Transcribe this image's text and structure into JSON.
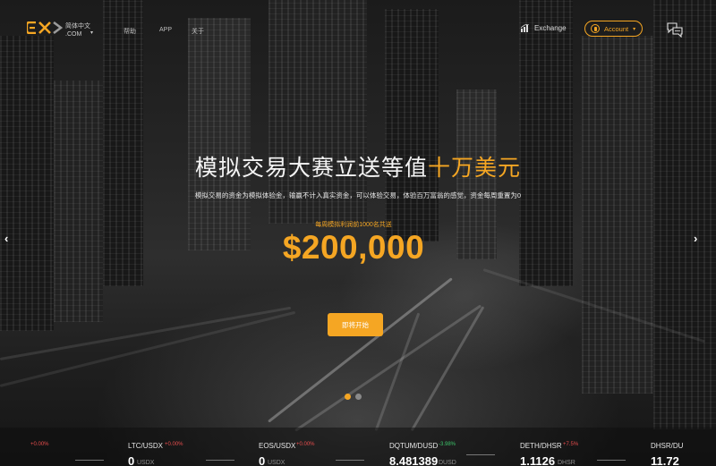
{
  "header": {
    "logo_text": "EXX",
    "language": "简体中文",
    "domain": ".COM",
    "nav": [
      "帮助",
      "APP",
      "关于"
    ],
    "exchange_label": "Exchange",
    "account_label": "Account",
    "icons": [
      "chart-icon",
      "user-icon",
      "chat-icon"
    ]
  },
  "hero": {
    "title_main": "模拟交易大赛立送等值",
    "title_highlight": "十万美元",
    "subtitle": "模拟交易的资金为模拟体验金，输赢不计入真实资金，可以体验交易，体验百万富翁的感觉，资金每周重置为0",
    "prize_note": "每周模拟利润前1000名共送",
    "prize_amount": "$200,000",
    "start_button": "即将开始"
  },
  "colors": {
    "accent": "#f5a623",
    "up": "#3cc46a",
    "down": "#e84d4d"
  },
  "ticker": [
    {
      "pair": "",
      "change": "+0.00%",
      "price": "",
      "unit": "",
      "dir": "down"
    },
    {
      "pair": "LTC/USDX",
      "change": "+0.00%",
      "price": "0",
      "unit": "USDX",
      "dir": "down"
    },
    {
      "pair": "EOS/USDX",
      "change": "+0.00%",
      "price": "0",
      "unit": "USDX",
      "dir": "down"
    },
    {
      "pair": "DQTUM/DUSD",
      "change": "-3.98%",
      "price": "8.481389",
      "unit": "DUSD",
      "dir": "up"
    },
    {
      "pair": "DETH/DHSR",
      "change": "+7.5%",
      "price": "1.1126",
      "unit": "DHSR",
      "dir": "down"
    },
    {
      "pair": "DHSR/DU",
      "change": "",
      "price": "11.72",
      "unit": "",
      "dir": "down"
    }
  ]
}
